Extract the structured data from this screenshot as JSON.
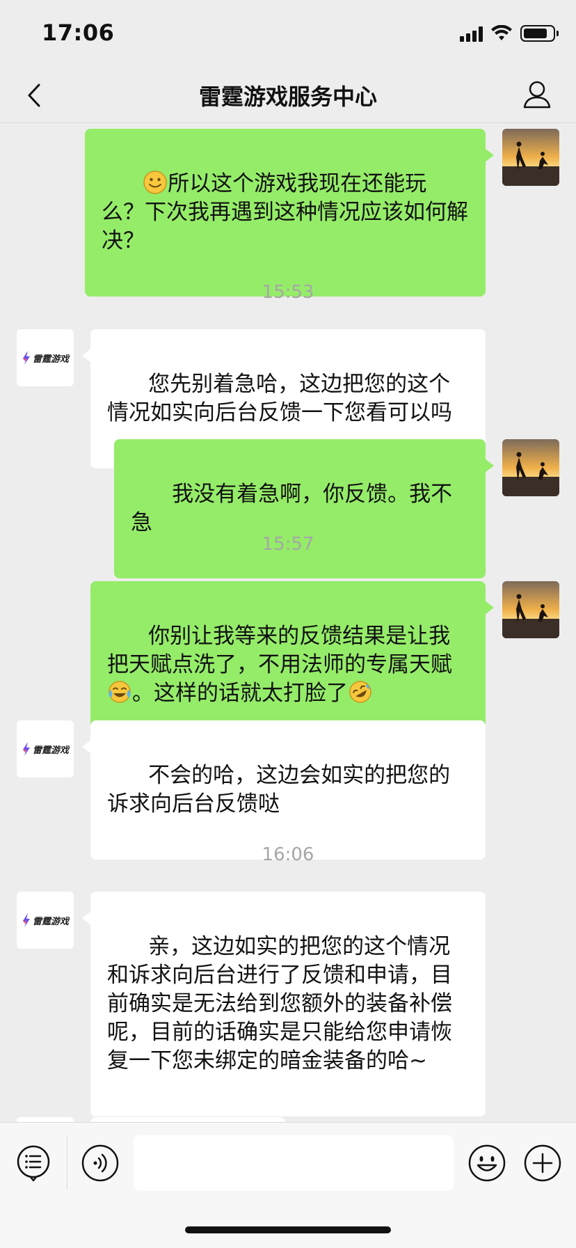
{
  "status_bar": {
    "time": "17:06",
    "battery_level": 0.85
  },
  "nav": {
    "title": "雷霆游戏服务中心"
  },
  "brand": {
    "name": "雷霆游戏",
    "accent": "#6c4cf1",
    "accent2": "#e94d6a"
  },
  "colors": {
    "outgoing_bubble": "#95ec69",
    "incoming_bubble": "#ffffff",
    "background": "#ededed"
  },
  "messages": [
    {
      "id": "m1",
      "from": "user",
      "lead_emoji": "smile-icon",
      "text": "所以这个游戏我现在还能玩么？下次我再遇到这种情况应该如何解决？"
    },
    {
      "id": "t1",
      "type": "time",
      "text": "15:53"
    },
    {
      "id": "m2",
      "from": "service",
      "text": "您先别着急哈，这边把您的这个情况如实向后台反馈一下您看可以吗"
    },
    {
      "id": "m3",
      "from": "user",
      "text": "我没有着急啊，你反馈。我不急"
    },
    {
      "id": "t2",
      "type": "time",
      "text": "15:57"
    },
    {
      "id": "m4",
      "from": "user",
      "text_part1": "你别让我等来的反馈结果是让我把天赋点洗了，不用法师的专属天赋",
      "inline_emoji_1": "tears-of-joy-icon",
      "text_part2": "。这样的话就太打脸了",
      "inline_emoji_2": "rolling-laughing-icon"
    },
    {
      "id": "m5",
      "from": "service",
      "text": "不会的哈，这边会如实的把您的诉求向后台反馈哒"
    },
    {
      "id": "t3",
      "type": "time",
      "text": "16:06"
    },
    {
      "id": "m6",
      "from": "service",
      "text": "亲，这边如实的把您的这个情况和诉求向后台进行了反馈和申请，目前确实是无法给到您额外的装备补偿呢，目前的话确实是只能给您申请恢复一下您未绑定的暗金装备的哈~"
    }
  ],
  "input_bar": {
    "icons": [
      "menu-list-icon",
      "voice-icon",
      "emoji-icon",
      "plus-icon"
    ]
  }
}
